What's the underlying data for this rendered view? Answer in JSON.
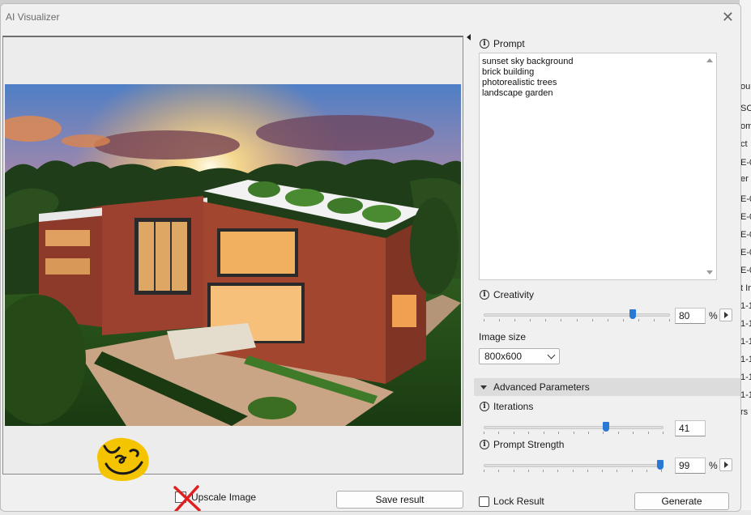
{
  "window": {
    "title": "AI Visualizer"
  },
  "left": {
    "upscale_label": "Upscale Image",
    "save_label": "Save result"
  },
  "prompt": {
    "label": "Prompt",
    "lines": [
      "sunset sky background",
      "brick building",
      "photorealistic trees",
      "landscape garden"
    ]
  },
  "creativity": {
    "label": "Creativity",
    "value": "80",
    "unit": "%",
    "level": 0.8
  },
  "image_size": {
    "label": "Image size",
    "selected": "800x600"
  },
  "advanced": {
    "label": "Advanced Parameters"
  },
  "iterations": {
    "label": "Iterations",
    "value": "41",
    "level": 0.68
  },
  "prompt_strength": {
    "label": "Prompt Strength",
    "value": "99",
    "unit": "%",
    "level": 0.99
  },
  "lock": {
    "label": "Lock Result"
  },
  "generate_label": "Generate",
  "background_fragments": [
    "ou",
    "SC",
    "om",
    "ct",
    "E-0",
    "er",
    "E-0",
    "E-0",
    "E-0",
    "E-0",
    "E-0",
    "t In",
    "1-1",
    "1-1",
    "1-1",
    "1-1",
    "1-1",
    "1-1",
    "rs"
  ],
  "colors": {
    "accent": "#2a78d6",
    "sticker": "#f5c400",
    "cross": "#e02020"
  }
}
